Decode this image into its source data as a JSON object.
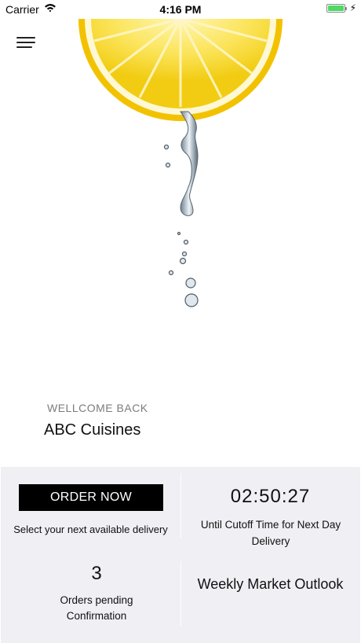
{
  "status_bar": {
    "carrier": "Carrier",
    "time": "4:16 PM",
    "wifi_icon": "wifi-icon",
    "battery_icon": "battery-icon",
    "battery_level": 1.0,
    "charging_icon": "bolt-icon",
    "battery_color": "#4cd964"
  },
  "header": {
    "menu_icon": "hamburger-menu-icon"
  },
  "hero": {
    "image": "lemon-slice-with-water-drip",
    "lemon_color": "#f7d417"
  },
  "welcome": {
    "label": "WELLCOME BACK",
    "name": "ABC Cuisines"
  },
  "dashboard": {
    "order_button_label": "ORDER NOW",
    "order_caption": "Select your next available delivery",
    "countdown": "02:50:27",
    "countdown_caption": "Until Cutoff Time for Next Day Delivery",
    "pending_count": "3",
    "pending_caption": "Orders pending Confirmation",
    "market_link_label": "Weekly Market Outlook",
    "panel_color": "#efeff4",
    "button_color": "#000000"
  }
}
